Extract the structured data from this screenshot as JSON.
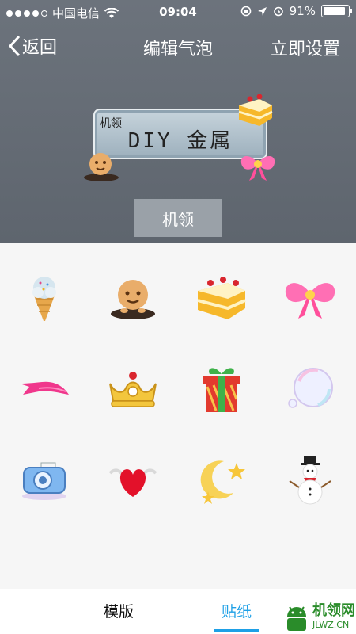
{
  "status_bar": {
    "carrier": "中国电信",
    "time": "09:04",
    "battery": "91%"
  },
  "nav": {
    "back_label": "返回",
    "title": "编辑气泡",
    "apply_label": "立即设置"
  },
  "preview": {
    "name": "机领",
    "text": "DIY 金属",
    "name_button": "机领"
  },
  "stickers": [
    {
      "icon": "ice-cream-icon"
    },
    {
      "icon": "cookie-icon"
    },
    {
      "icon": "cake-icon"
    },
    {
      "icon": "bow-icon"
    },
    {
      "icon": "ribbon-icon"
    },
    {
      "icon": "crown-icon"
    },
    {
      "icon": "gift-icon"
    },
    {
      "icon": "soap-bubble-icon"
    },
    {
      "icon": "camera-icon"
    },
    {
      "icon": "heart-icon"
    },
    {
      "icon": "moon-star-icon"
    },
    {
      "icon": "snowman-icon"
    }
  ],
  "tabs": [
    {
      "label": "模版"
    },
    {
      "label": "贴纸"
    }
  ],
  "active_tab": "贴纸",
  "watermark": {
    "text": "机领网",
    "url": "JLWZ.CN"
  },
  "colors": {
    "accent": "#1ea0e6",
    "header_bg": "#656c75",
    "name_button_bg": "#9aa1a8"
  }
}
